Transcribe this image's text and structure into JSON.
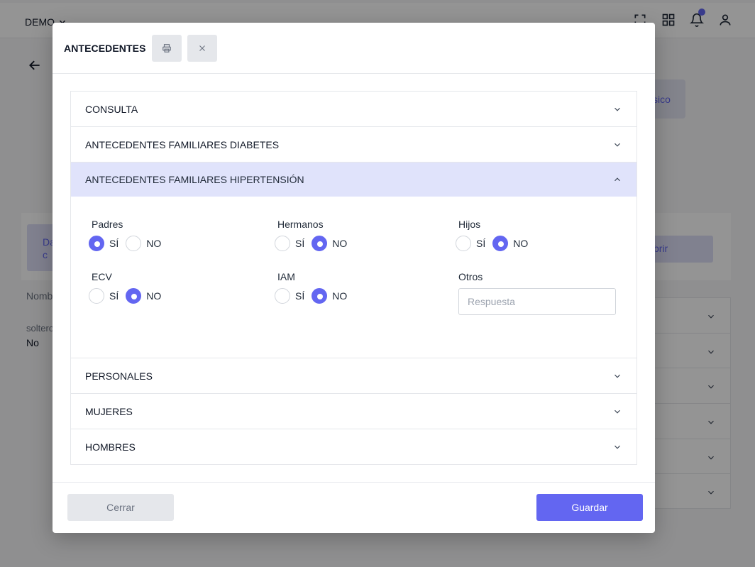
{
  "background": {
    "workspace_label": "DEMO",
    "back_text": "",
    "right_button_partial": "sico",
    "tab_left_partial": "Da\nc",
    "tab_right_partial": "brir",
    "label_name_partial": "Nomb",
    "label_soltero_partial": "soltero",
    "value_soltero": "No",
    "icons": [
      "fullscreen-icon",
      "apps-grid-icon",
      "bell-icon",
      "user-icon"
    ],
    "notification_color": "#6366f1"
  },
  "modal": {
    "title": "ANTECEDENTES",
    "print_icon": "printer-icon",
    "close_icon": "close-icon",
    "sections": [
      {
        "label": "CONSULTA",
        "open": false
      },
      {
        "label": "ANTECEDENTES FAMILIARES DIABETES",
        "open": false
      },
      {
        "label": "ANTECEDENTES FAMILIARES HIPERTENSIÓN",
        "open": true
      },
      {
        "label": "PERSONALES",
        "open": false
      },
      {
        "label": "MUJERES",
        "open": false
      },
      {
        "label": "HOMBRES",
        "open": false
      }
    ],
    "hipertension": {
      "yes_label": "SÍ",
      "no_label": "NO",
      "fields": [
        {
          "label": "Padres",
          "selected": "SÍ"
        },
        {
          "label": "Hermanos",
          "selected": "NO"
        },
        {
          "label": "Hijos",
          "selected": "NO"
        },
        {
          "label": "ECV",
          "selected": "NO"
        },
        {
          "label": "IAM",
          "selected": "NO"
        }
      ],
      "otros": {
        "label": "Otros",
        "placeholder": "Respuesta",
        "value": ""
      }
    },
    "footer": {
      "close_label": "Cerrar",
      "save_label": "Guardar"
    }
  },
  "colors": {
    "accent": "#6366f1",
    "open_section_bg": "#e0e3fb",
    "secondary_button_bg": "#e5e7eb"
  }
}
